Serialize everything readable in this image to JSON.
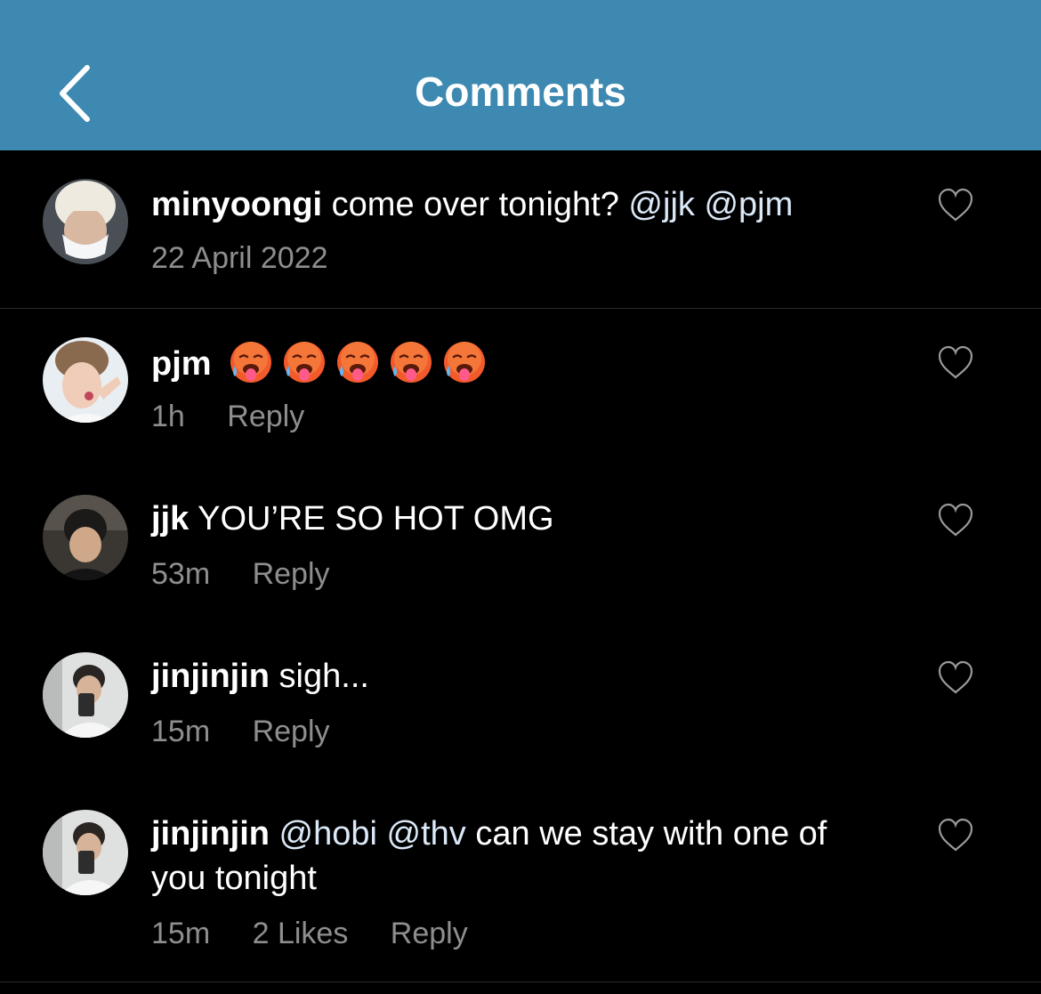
{
  "header": {
    "title": "Comments",
    "back_icon": "chevron-left-icon",
    "bg_color": "#3d89b1"
  },
  "caption": {
    "username": "minyoongi",
    "text": "come over tonight?",
    "mentions": [
      "@jjk",
      "@pjm"
    ],
    "date": "22 April 2022"
  },
  "comments": [
    {
      "username": "pjm",
      "emoji": "hot-face-sweat-emoji",
      "emoji_count": 5,
      "time": "1h",
      "reply_label": "Reply"
    },
    {
      "username": "jjk",
      "text": "YOU’RE SO HOT OMG",
      "time": "53m",
      "reply_label": "Reply"
    },
    {
      "username": "jinjinjin",
      "text": "sigh...",
      "time": "15m",
      "reply_label": "Reply"
    },
    {
      "username": "jinjinjin",
      "mentions": [
        "@hobi",
        "@thv"
      ],
      "text": "can we stay with one of you tonight",
      "time": "15m",
      "likes": "2 Likes",
      "reply_label": "Reply"
    }
  ],
  "icons": {
    "like": "heart-outline-icon"
  },
  "colors": {
    "background": "#000000",
    "meta_text": "#8e8e8e",
    "mention": "#dbe8f7"
  }
}
